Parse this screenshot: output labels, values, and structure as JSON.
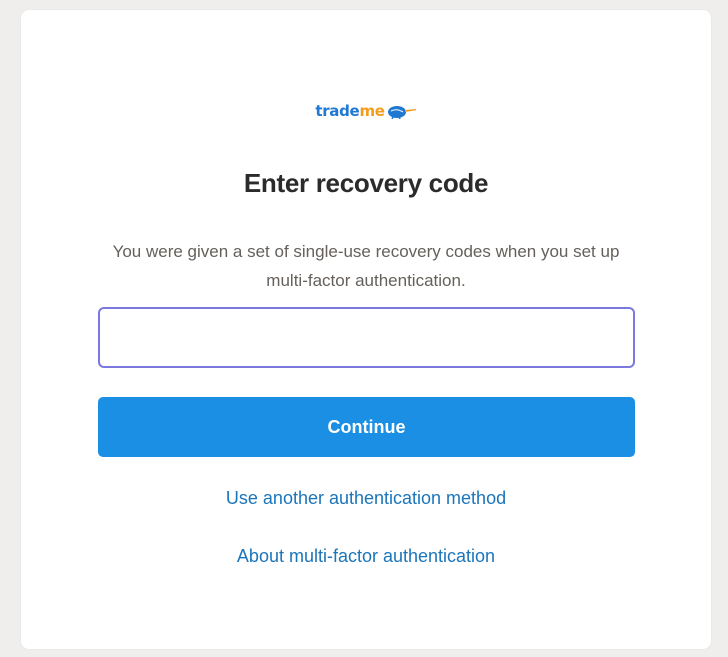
{
  "logo": {
    "part1": "trade",
    "part2": "me",
    "colors": {
      "trade": "#1f78d1",
      "me": "#f59c1a"
    },
    "icon": "kiwi-bird-icon"
  },
  "title": "Enter recovery code",
  "description": "You were given a set of single-use recovery codes when you set up multi-factor authentication.",
  "code_input": {
    "value": "",
    "placeholder": ""
  },
  "continue_label": "Continue",
  "links": {
    "alternate_method": "Use another authentication method",
    "about_mfa": "About multi-factor authentication"
  },
  "colors": {
    "primary_button": "#1a8fe3",
    "link": "#1b75bb",
    "input_focus_border": "#7b79e0",
    "page_background": "#efeeed"
  }
}
